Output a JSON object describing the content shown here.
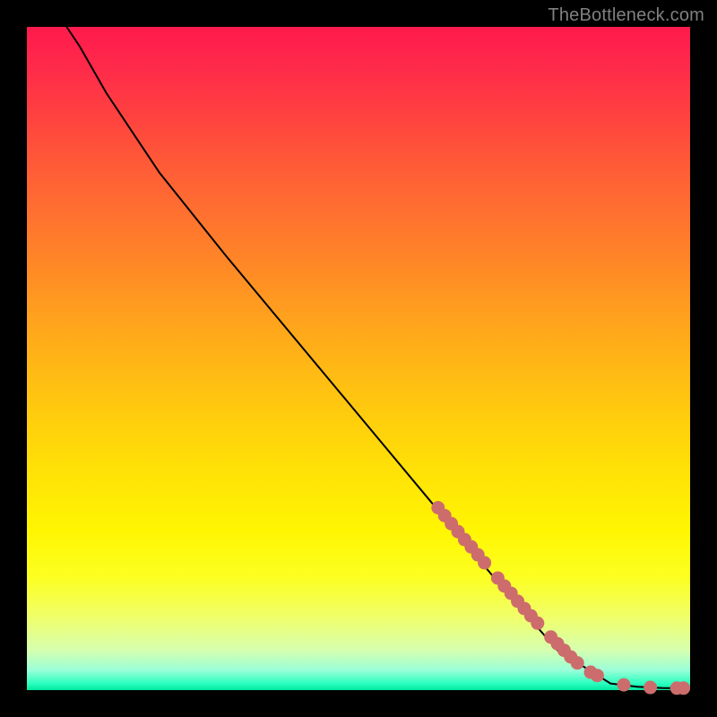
{
  "watermark": "TheBottleneck.com",
  "colors": {
    "curve_stroke": "#000000",
    "marker_fill": "#cd6c6c",
    "marker_stroke": "#b35a5a"
  },
  "chart_data": {
    "type": "scatter",
    "title": "",
    "xlabel": "",
    "ylabel": "",
    "xlim": [
      0,
      100
    ],
    "ylim": [
      0,
      100
    ],
    "series": [
      {
        "name": "curve",
        "kind": "line",
        "x": [
          6,
          8,
          10,
          12,
          16,
          20,
          30,
          40,
          50,
          60,
          70,
          80,
          88,
          92,
          94,
          96,
          98,
          100
        ],
        "y": [
          100,
          97,
          93.5,
          90,
          84,
          78,
          65.5,
          53.5,
          41.5,
          29.5,
          17.5,
          6,
          1,
          0.5,
          0.4,
          0.3,
          0.3,
          0.3
        ]
      },
      {
        "name": "markers",
        "kind": "scatter",
        "x": [
          62,
          63,
          64,
          65,
          66,
          67,
          68,
          69,
          71,
          72,
          73,
          74,
          75,
          76,
          77,
          79,
          80,
          81,
          82,
          83,
          85,
          86,
          90,
          94,
          98,
          99
        ],
        "y": [
          27.5,
          26.3,
          25.1,
          23.9,
          22.7,
          21.6,
          20.4,
          19.2,
          16.9,
          15.7,
          14.6,
          13.4,
          12.3,
          11.2,
          10.1,
          8.0,
          7.0,
          6.0,
          5.0,
          4.1,
          2.7,
          2.2,
          0.8,
          0.4,
          0.3,
          0.3
        ]
      }
    ]
  }
}
